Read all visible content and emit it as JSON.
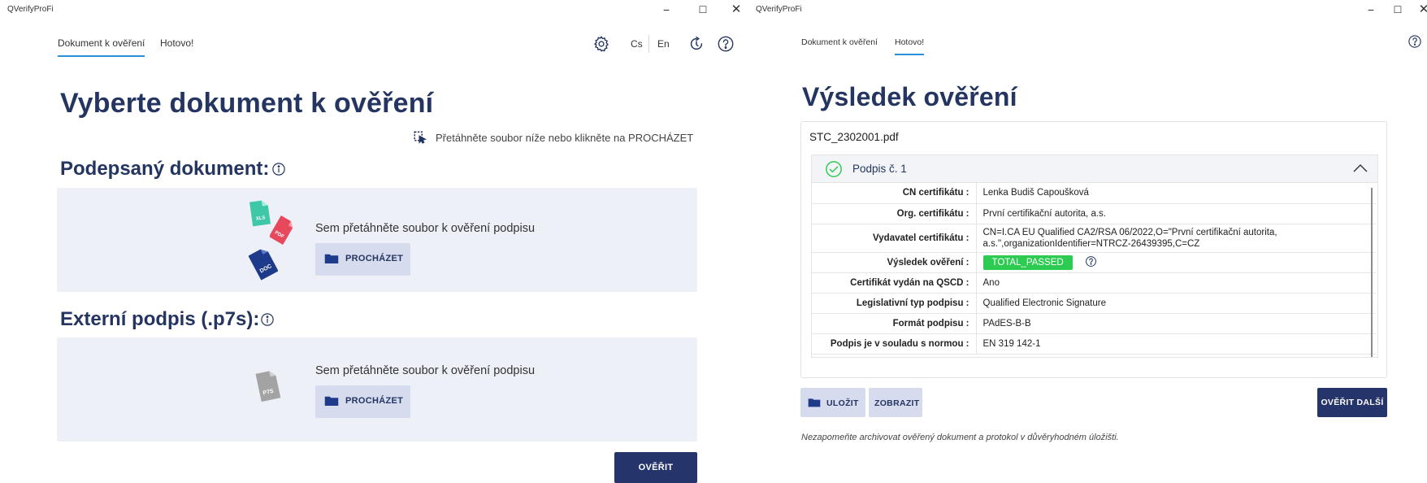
{
  "left_window": {
    "app_title": "QVerifyProFi",
    "window_controls": {
      "minimize": "−",
      "maximize": "☐",
      "close": "✕"
    },
    "tabs": [
      {
        "label": "Dokument k ověření",
        "active": true
      },
      {
        "label": "Hotovo!",
        "active": false
      }
    ],
    "toolbar": {
      "settings_icon": "gear-icon",
      "lang_cs": "Cs",
      "lang_en": "En",
      "refresh_icon": "refresh-icon",
      "help_icon": "help-icon"
    },
    "page_title": "Vyberte dokument k ověření",
    "drag_hint": "Přetáhněte soubor níže nebo klikněte na PROCHÁZET",
    "signed_section": {
      "title": "Podepsaný dokument:",
      "drop_text": "Sem přetáhněte soubor k ověření podpisu",
      "browse_label": "PROCHÁZET",
      "file_icons": [
        {
          "name": "xls-file-icon",
          "label": "XLS",
          "color": "#3ec8a8"
        },
        {
          "name": "pdf-file-icon",
          "label": "PDF",
          "color": "#e8485c"
        },
        {
          "name": "doc-file-icon",
          "label": "DOC",
          "color": "#1e3a8a"
        }
      ]
    },
    "external_section": {
      "title": "Externí podpis (.p7s):",
      "drop_text": "Sem přetáhněte soubor k ověření podpisu",
      "browse_label": "PROCHÁZET",
      "file_icon": {
        "name": "p7s-file-icon",
        "label": "P7S",
        "color": "#a3a3a3"
      }
    },
    "verify_button": "OVĚŘIT"
  },
  "right_window": {
    "app_title": "QVerifyProFi",
    "window_controls": {
      "minimize": "−",
      "maximize": "☐",
      "close": "✕"
    },
    "tabs": [
      {
        "label": "Dokument k ověření",
        "active": false
      },
      {
        "label": "Hotovo!",
        "active": true
      }
    ],
    "help_icon": "help-icon",
    "page_title": "Výsledek ověření",
    "file_name": "STC_2302001.pdf",
    "signature": {
      "title": "Podpis č. 1",
      "status_icon": "check-circle-icon",
      "rows": [
        {
          "key": "CN certifikátu :",
          "value": "Lenka Budiš Capoušková"
        },
        {
          "key": "Org. certifikátu :",
          "value": "První certifikační autorita, a.s."
        },
        {
          "key": "Vydavatel certifikátu :",
          "value_line1": "CN=I.CA EU Qualified CA2/RSA 06/2022,O=\"První certifikační autorita,",
          "value_line2": "a.s.\",organizationIdentifier=NTRCZ-26439395,C=CZ"
        },
        {
          "key": "Výsledek ověření :",
          "badge": "TOTAL_PASSED"
        },
        {
          "key": "Certifikát vydán na QSCD :",
          "value": "Ano"
        },
        {
          "key": "Legislativní typ podpisu :",
          "value": "Qualified Electronic Signature"
        },
        {
          "key": "Formát podpisu :",
          "value": "PAdES-B-B"
        },
        {
          "key": "Podpis je v souladu s normou :",
          "value": "EN 319 142-1"
        }
      ]
    },
    "save_button": "ULOŽIT",
    "show_button": "ZOBRAZIT",
    "verify_next_button": "OVĚŘIT DALŠÍ",
    "footer_note": "Nezapomeňte archivovat ověřený dokument a protokol v důvěryhodném úložišti."
  },
  "colors": {
    "primary": "#25346a",
    "heading": "#233560",
    "tab_underline": "#2b8fd6",
    "dropzone_bg": "#eef0f8",
    "button_secondary_bg": "#d6dbee",
    "success": "#2ecb52"
  }
}
